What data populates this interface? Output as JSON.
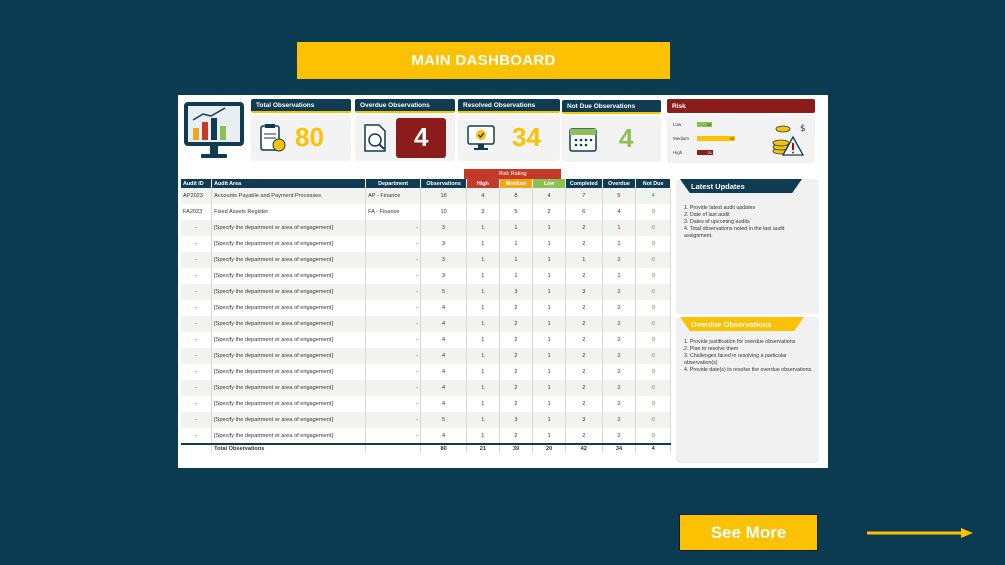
{
  "banner": {
    "title": "MAIN DASHBOARD"
  },
  "kpis": {
    "total": {
      "label": "Total Observations",
      "value": "80",
      "color": "#fbc102"
    },
    "overdue": {
      "label": "Overdue Observations",
      "value": "4",
      "color": "#8a1c1c"
    },
    "resolved": {
      "label": "Resolved Observations",
      "value": "34",
      "color": "#fbc102"
    },
    "not_due": {
      "label": "Not Due Observations",
      "value": "4",
      "color": "#8cc152"
    }
  },
  "risk": {
    "label": "Risk",
    "rows": [
      {
        "level": "Low",
        "value": "20"
      },
      {
        "level": "Medium",
        "value": "39"
      },
      {
        "level": "High",
        "value": "21"
      }
    ]
  },
  "table": {
    "group_header": "Risk Rating",
    "headers": [
      "Audit ID",
      "Audit Area",
      "Department",
      "Observations",
      "High",
      "Medium",
      "Low",
      "Completed",
      "Overdue",
      "Not Due"
    ],
    "rows": [
      [
        "AP2023",
        "Accounts Payable and Payment Processes",
        "AP - Finance",
        "16",
        "4",
        "8",
        "4",
        "7",
        "5",
        "4"
      ],
      [
        "FA2023",
        "Fixed Assets Register",
        "FA - Finance",
        "10",
        "3",
        "5",
        "2",
        "6",
        "4",
        "0"
      ],
      [
        "-",
        "[Specify the department or area of engagement]",
        "-",
        "3",
        "1",
        "1",
        "1",
        "2",
        "1",
        "0"
      ],
      [
        "-",
        "[Specify the department or area of engagement]",
        "-",
        "3",
        "1",
        "1",
        "1",
        "2",
        "1",
        "0"
      ],
      [
        "-",
        "[Specify the department or area of engagement]",
        "-",
        "3",
        "1",
        "1",
        "1",
        "1",
        "2",
        "0"
      ],
      [
        "-",
        "[Specify the department or area of engagement]",
        "-",
        "3",
        "1",
        "1",
        "1",
        "2",
        "1",
        "0"
      ],
      [
        "-",
        "[Specify the department or area of engagement]",
        "-",
        "5",
        "1",
        "3",
        "1",
        "3",
        "2",
        "0"
      ],
      [
        "-",
        "[Specify the department or area of engagement]",
        "-",
        "4",
        "1",
        "2",
        "1",
        "2",
        "2",
        "0"
      ],
      [
        "-",
        "[Specify the department or area of engagement]",
        "-",
        "4",
        "1",
        "2",
        "1",
        "2",
        "2",
        "0"
      ],
      [
        "-",
        "[Specify the department or area of engagement]",
        "-",
        "4",
        "1",
        "2",
        "1",
        "2",
        "2",
        "0"
      ],
      [
        "-",
        "[Specify the department or area of engagement]",
        "-",
        "4",
        "1",
        "2",
        "1",
        "2",
        "2",
        "0"
      ],
      [
        "-",
        "[Specify the department or area of engagement]",
        "-",
        "4",
        "1",
        "2",
        "1",
        "2",
        "2",
        "0"
      ],
      [
        "-",
        "[Specify the department or area of engagement]",
        "-",
        "4",
        "1",
        "2",
        "1",
        "2",
        "2",
        "0"
      ],
      [
        "-",
        "[Specify the department or area of engagement]",
        "-",
        "4",
        "1",
        "2",
        "1",
        "2",
        "2",
        "0"
      ],
      [
        "-",
        "[Specify the department or area of engagement]",
        "-",
        "5",
        "1",
        "3",
        "1",
        "3",
        "2",
        "0"
      ],
      [
        "-",
        "[Specify the department or area of engagement]",
        "-",
        "4",
        "1",
        "2",
        "1",
        "2",
        "2",
        "0"
      ]
    ],
    "total": [
      "",
      "Total Observations",
      "",
      "80",
      "21",
      "39",
      "20",
      "42",
      "34",
      "4"
    ]
  },
  "latest_updates": {
    "title": "Latest Updates",
    "lines": [
      "1. Provide latest audit updates",
      "2. Date of last audit",
      "3. Dates of upcoming audits",
      "4. Total observations noted in the last audit assignment."
    ]
  },
  "overdue_panel": {
    "title": "Overdue Observations",
    "lines": [
      "1. Provide justification for overdue observations",
      "2. Plan to resolve them",
      "3. Challenges faced in resolving a particular observation(s)",
      "4. Provide date(s) to resolve the overdue observations."
    ]
  },
  "see_more": {
    "label": "See More"
  },
  "colors": {
    "navy": "#0f3c53",
    "gold": "#fbc102",
    "red": "#c00000",
    "green": "#2d9d3a"
  }
}
